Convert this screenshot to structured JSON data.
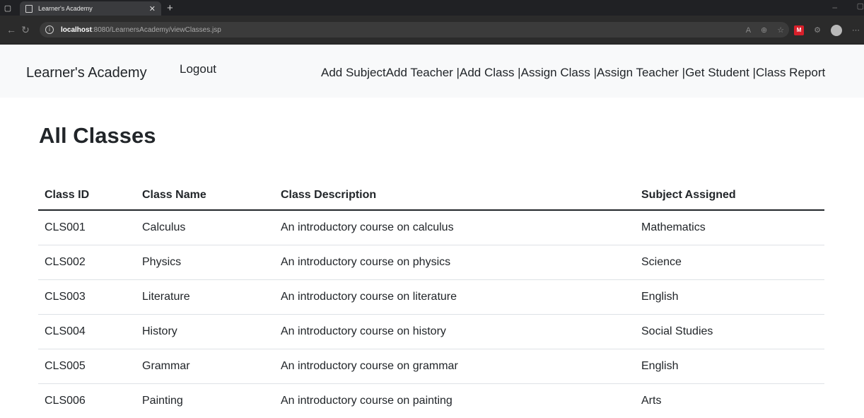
{
  "browser": {
    "tab_title": "Learner's Academy",
    "url_host": "localhost",
    "url_path": ":8080/LearnersAcademy/viewClasses.jsp",
    "ext_label": "M"
  },
  "navbar": {
    "brand": "Learner's Academy",
    "logout": "Logout",
    "links": [
      "Add Subject",
      "Add Teacher |",
      "Add Class |",
      "Assign Class |",
      "Assign Teacher |",
      "Get Student |",
      "Class Report"
    ]
  },
  "page": {
    "title": "All Classes"
  },
  "table": {
    "headers": [
      "Class ID",
      "Class Name",
      "Class Description",
      "Subject Assigned"
    ],
    "rows": [
      [
        "CLS001",
        "Calculus",
        "An introductory course on calculus",
        "Mathematics"
      ],
      [
        "CLS002",
        "Physics",
        "An introductory course on physics",
        "Science"
      ],
      [
        "CLS003",
        "Literature",
        "An introductory course on literature",
        "English"
      ],
      [
        "CLS004",
        "History",
        "An introductory course on history",
        "Social Studies"
      ],
      [
        "CLS005",
        "Grammar",
        "An introductory course on grammar",
        "English"
      ],
      [
        "CLS006",
        "Painting",
        "An introductory course on painting",
        "Arts"
      ]
    ]
  }
}
